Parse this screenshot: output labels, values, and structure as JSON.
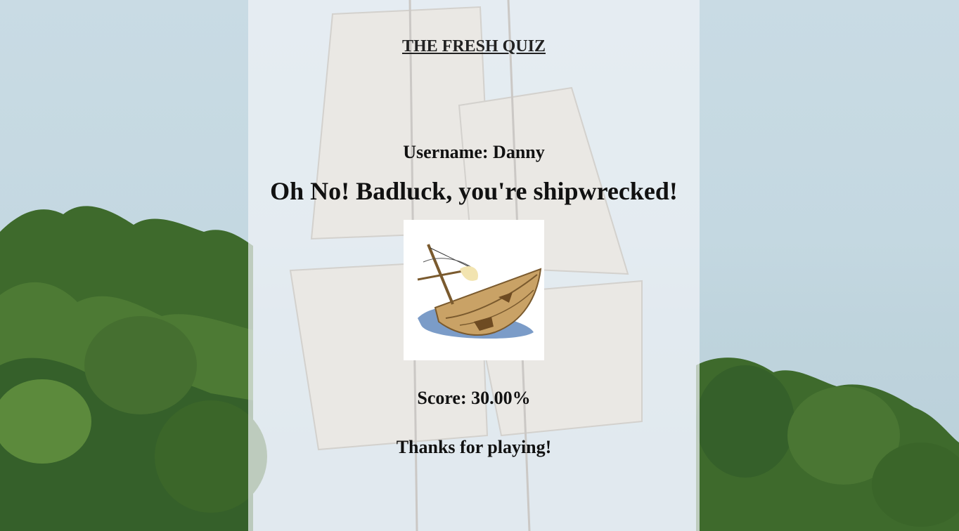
{
  "header": {
    "title": "THE FRESH QUIZ"
  },
  "result": {
    "username_label": "Username: Danny",
    "headline": "Oh No! Badluck, you're shipwrecked!",
    "image_icon": "shipwreck-illustration",
    "score_label": "Score: 30.00%",
    "thanks": "Thanks for playing!"
  },
  "colors": {
    "panel": "#f0f3f6",
    "sky": "#c4d8e1",
    "trees": "#3f6b2e",
    "sail": "#e9ddcc",
    "ship_wood": "#c9a266",
    "water": "#7b9cc8"
  }
}
